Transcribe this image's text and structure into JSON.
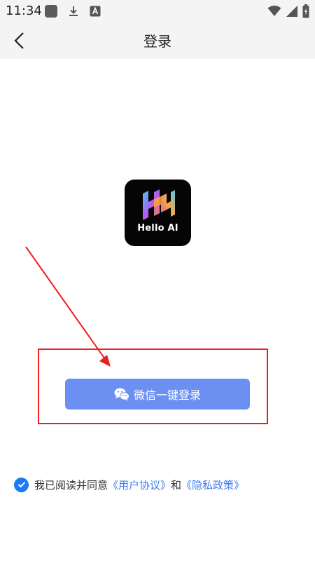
{
  "status_bar": {
    "time": "11:34",
    "icons": [
      "app-square-icon",
      "download-icon",
      "a-notification-icon",
      "wifi-icon",
      "signal-icon",
      "battery-icon"
    ]
  },
  "header": {
    "title": "登录",
    "back_icon": "chevron-left-icon"
  },
  "logo": {
    "text": "Hello AI"
  },
  "login": {
    "wechat_button_label": "微信一键登录",
    "button_color": "#6b90f2"
  },
  "agreement": {
    "prefix": "我已阅读并同意",
    "user_agreement": "《用户协议》",
    "and": "和",
    "privacy_policy": "《隐私政策》",
    "checked": true,
    "accent_color": "#1a7bf6"
  },
  "annotation": {
    "color": "#ee1c1c"
  }
}
